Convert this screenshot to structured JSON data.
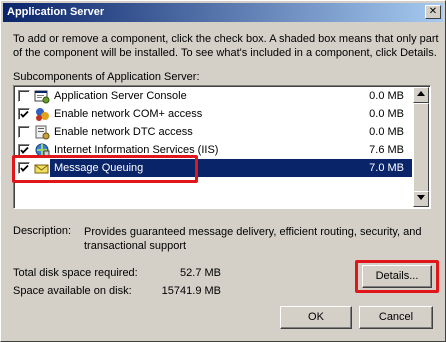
{
  "window": {
    "title": "Application Server",
    "close_glyph": "✕"
  },
  "intro_text": "To add or remove a component, click the check box. A shaded box means that only part of the component will be installed. To see what's included in a component, click Details.",
  "list_label": "Subcomponents of Application Server:",
  "components": [
    {
      "label": "Application Server Console",
      "size": "0.0 MB",
      "checked": false,
      "icon": "console-icon"
    },
    {
      "label": "Enable network COM+ access",
      "size": "0.0 MB",
      "checked": true,
      "icon": "com-plus-icon"
    },
    {
      "label": "Enable network DTC access",
      "size": "0.0 MB",
      "checked": false,
      "icon": "dtc-icon"
    },
    {
      "label": "Internet Information Services (IIS)",
      "size": "7.6 MB",
      "checked": true,
      "icon": "iis-icon"
    },
    {
      "label": "Message Queuing",
      "size": "7.0 MB",
      "checked": true,
      "icon": "message-queuing-icon",
      "selected": true
    }
  ],
  "description": {
    "label": "Description:",
    "text": "Provides guaranteed message delivery, efficient routing, security, and transactional support"
  },
  "disk": {
    "required_label": "Total disk space required:",
    "required_value": "52.7 MB",
    "available_label": "Space available on disk:",
    "available_value": "15741.9 MB"
  },
  "buttons": {
    "details": "Details...",
    "ok": "OK",
    "cancel": "Cancel"
  },
  "colors": {
    "selection": "#0a246a",
    "highlight_box": "#e0161b"
  }
}
